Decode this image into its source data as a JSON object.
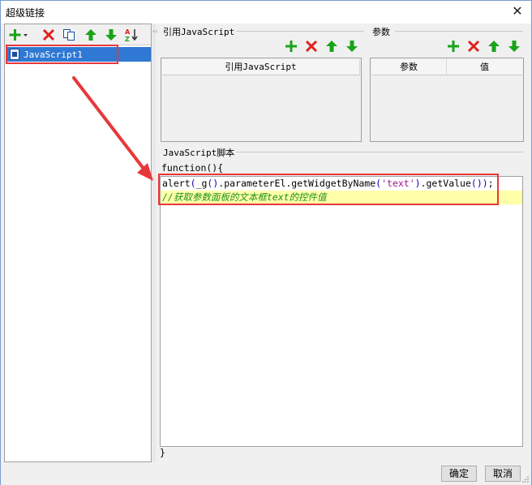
{
  "window": {
    "title": "超级链接",
    "close_glyph": "✕"
  },
  "left": {
    "toolbar_icons": [
      "add-icon",
      "delete-icon",
      "copy-icon",
      "move-up-icon",
      "move-down-icon",
      "sort-icon"
    ],
    "tree_items": [
      {
        "label": "JavaScript1",
        "icon": "js-document-icon",
        "selected": true
      }
    ]
  },
  "splitter": {
    "arrows": "‹‹"
  },
  "ref_js": {
    "group_label": "引用JavaScript",
    "column_header": "引用JavaScript"
  },
  "params": {
    "group_label": "参数",
    "col_param": "参数",
    "col_value": "值"
  },
  "script": {
    "group_label": "JavaScript脚本",
    "function_open": "function(){",
    "function_close": "}",
    "code": {
      "line1_a": "alert",
      "line1_b": "(",
      "line1_c": "_g",
      "line1_d": "()",
      "line1_e": ".parameterEl.getWidgetByName",
      "line1_f": "(",
      "line1_g": "'text'",
      "line1_h": ")",
      "line1_i": ".getValue",
      "line1_j": "())",
      "line1_k": ";",
      "line2": "//获取参数面板的文本框text的控件值"
    }
  },
  "footer": {
    "ok_label": "确定",
    "cancel_label": "取消"
  },
  "colors": {
    "selection": "#2f78d3",
    "highlight_line": "#ffffa8",
    "annotation_red": "#e8373b",
    "add_green": "#1aa31a",
    "delete_red": "#e02020"
  }
}
